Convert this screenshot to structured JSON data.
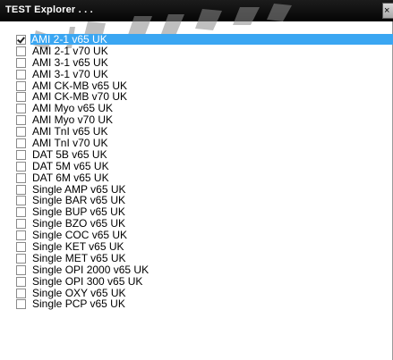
{
  "window": {
    "title": "TEST Explorer . . .",
    "close_glyph": "×"
  },
  "tests": [
    {
      "label": "AMI 2-1 v65 UK",
      "checked": true,
      "selected": true
    },
    {
      "label": "AMI 2-1 v70 UK",
      "checked": false,
      "selected": false
    },
    {
      "label": "AMI 3-1 v65 UK",
      "checked": false,
      "selected": false
    },
    {
      "label": "AMI 3-1 v70 UK",
      "checked": false,
      "selected": false
    },
    {
      "label": "AMI CK-MB v65 UK",
      "checked": false,
      "selected": false
    },
    {
      "label": "AMI CK-MB v70 UK",
      "checked": false,
      "selected": false
    },
    {
      "label": "AMI Myo v65 UK",
      "checked": false,
      "selected": false
    },
    {
      "label": "AMI Myo v70 UK",
      "checked": false,
      "selected": false
    },
    {
      "label": "AMI TnI v65 UK",
      "checked": false,
      "selected": false
    },
    {
      "label": "AMI TnI v70 UK",
      "checked": false,
      "selected": false
    },
    {
      "label": "DAT 5B v65 UK",
      "checked": false,
      "selected": false
    },
    {
      "label": "DAT 5M v65 UK",
      "checked": false,
      "selected": false
    },
    {
      "label": "DAT 6M v65 UK",
      "checked": false,
      "selected": false
    },
    {
      "label": "Single AMP v65 UK",
      "checked": false,
      "selected": false
    },
    {
      "label": "Single BAR v65 UK",
      "checked": false,
      "selected": false
    },
    {
      "label": "Single BUP v65 UK",
      "checked": false,
      "selected": false
    },
    {
      "label": "Single BZO v65 UK",
      "checked": false,
      "selected": false
    },
    {
      "label": "Single COC v65 UK",
      "checked": false,
      "selected": false
    },
    {
      "label": "Single KET v65 UK",
      "checked": false,
      "selected": false
    },
    {
      "label": "Single MET v65 UK",
      "checked": false,
      "selected": false
    },
    {
      "label": "Single OPI 2000 v65 UK",
      "checked": false,
      "selected": false
    },
    {
      "label": "Single OPI 300 v65 UK",
      "checked": false,
      "selected": false
    },
    {
      "label": "Single OXY v65 UK",
      "checked": false,
      "selected": false
    },
    {
      "label": "Single PCP v65 UK",
      "checked": false,
      "selected": false
    }
  ],
  "colors": {
    "selection": "#3aa6f2",
    "titlebar": "#0a0a0a"
  }
}
